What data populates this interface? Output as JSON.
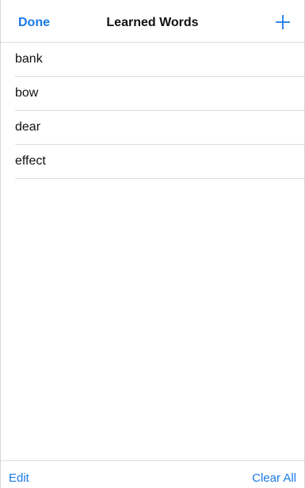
{
  "navbar": {
    "done_label": "Done",
    "title": "Learned Words",
    "add_icon": "plus-icon"
  },
  "words": [
    "bank",
    "bow",
    "dear",
    "effect"
  ],
  "toolbar": {
    "edit_label": "Edit",
    "clear_all_label": "Clear All"
  },
  "colors": {
    "accent": "#1a7ae6",
    "separator": "#dcdcdc"
  }
}
